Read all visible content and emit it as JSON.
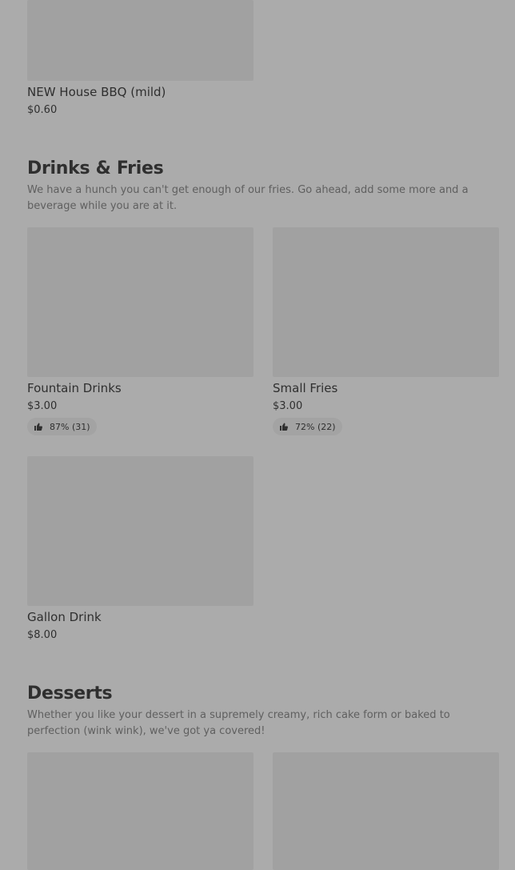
{
  "top_item": {
    "name": "NEW House BBQ (mild)",
    "price": "$0.60"
  },
  "sections": [
    {
      "title": "Drinks & Fries",
      "description": "We have a hunch you can't get enough of our fries. Go ahead, add some more and a beverage while you are at it.",
      "items": [
        {
          "name": "Fountain Drinks",
          "price": "$3.00",
          "rating": "87% (31)"
        },
        {
          "name": "Small Fries",
          "price": "$3.00",
          "rating": "72% (22)"
        },
        {
          "name": "Gallon Drink",
          "price": "$8.00"
        }
      ]
    },
    {
      "title": "Desserts",
      "description": "Whether you like your dessert in a supremely creamy, rich cake form or baked to perfection (wink wink), we've got ya covered!"
    }
  ],
  "icons": {
    "thumb": "thumbs-up-icon"
  }
}
